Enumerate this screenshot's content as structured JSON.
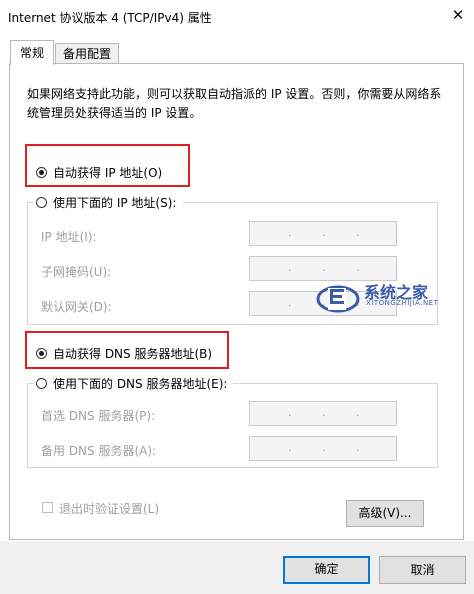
{
  "window": {
    "title": "Internet 协议版本 4 (TCP/IPv4) 属性",
    "close_glyph": "✕"
  },
  "tabs": [
    {
      "label": "常规",
      "active": true
    },
    {
      "label": "备用配置",
      "active": false
    }
  ],
  "description": "如果网络支持此功能，则可以获取自动指派的 IP 设置。否则，你需要从网络系统管理员处获得适当的 IP 设置。",
  "ip_section": {
    "auto_label": "自动获得 IP 地址(O)",
    "auto_selected": true,
    "manual_label": "使用下面的 IP 地址(S):",
    "fields": [
      {
        "label": "IP 地址(I):",
        "value": ".   .   ."
      },
      {
        "label": "子网掩码(U):",
        "value": ".   .   ."
      },
      {
        "label": "默认网关(D):",
        "value": ".   .   ."
      }
    ]
  },
  "dns_section": {
    "auto_label": "自动获得 DNS 服务器地址(B)",
    "auto_selected": true,
    "manual_label": "使用下面的 DNS 服务器地址(E):",
    "fields": [
      {
        "label": "首选 DNS 服务器(P):",
        "value": ".   .   ."
      },
      {
        "label": "备用 DNS 服务器(A):",
        "value": ".   .   ."
      }
    ]
  },
  "validate_on_exit": {
    "label": "退出时验证设置(L)",
    "checked": false,
    "enabled": false
  },
  "buttons": {
    "advanced": "高级(V)...",
    "ok": "确定",
    "cancel": "取消"
  },
  "watermark": {
    "name": "系统之家",
    "url": "XITONGZHIJIA.NET"
  },
  "colors": {
    "highlight_box": "#e02020",
    "default_button_border": "#0078d7",
    "watermark": "#3b5aa8"
  }
}
